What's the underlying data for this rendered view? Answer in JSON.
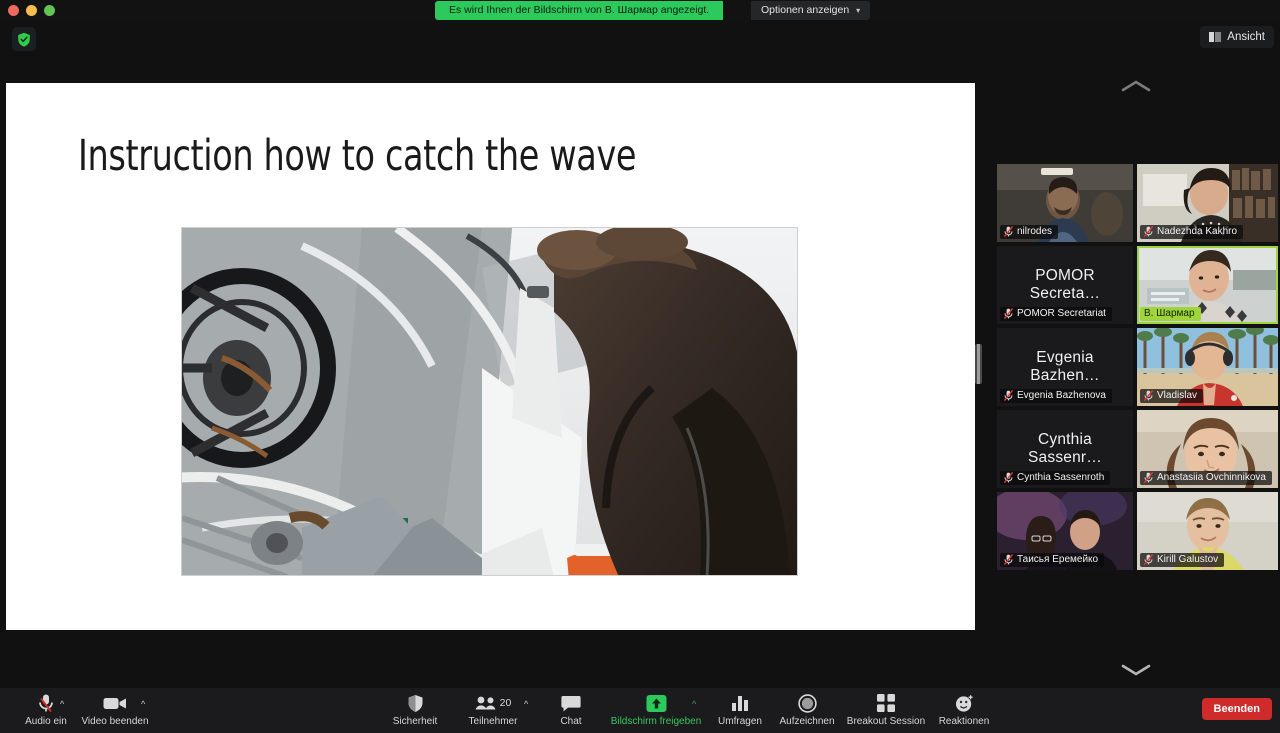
{
  "window": {
    "traffic_lights": [
      "close",
      "minimize",
      "zoom"
    ],
    "share_banner": "Es wird Ihnen der Bildschirm von B. Шармар angezeigt.",
    "share_options_label": "Optionen anzeigen",
    "view_button_label": "Ansicht",
    "security_badge": "shield-check-icon"
  },
  "shared_screen": {
    "slide_title": "Instruction how to catch the wave",
    "photo_alt": "Person in fur-hooded jacket climbing ship deck structure"
  },
  "participants_panel": {
    "scroll_up": "chevron-up-icon",
    "scroll_down": "chevron-down-icon",
    "tiles": [
      [
        {
          "name": "nilrodes",
          "initials": "",
          "muted": true,
          "video": true,
          "active": false,
          "vclass": "v-nilrodes"
        },
        {
          "name": "Nadezhda Kakhro",
          "initials": "",
          "muted": true,
          "video": true,
          "active": false,
          "vclass": "v-nadezhda"
        }
      ],
      [
        {
          "name": "POMOR Secretariat",
          "initials": "POMOR Secreta…",
          "muted": true,
          "video": false,
          "active": false,
          "vclass": ""
        },
        {
          "name": "В. Шармар",
          "initials": "",
          "muted": false,
          "video": true,
          "active": true,
          "vclass": "v-sharmap"
        }
      ],
      [
        {
          "name": "Evgenia Bazhenova",
          "initials": "Evgenia Bazhen…",
          "muted": true,
          "video": false,
          "active": false,
          "vclass": ""
        },
        {
          "name": "Vladislav",
          "initials": "",
          "muted": true,
          "video": true,
          "active": false,
          "vclass": "v-vladislav"
        }
      ],
      [
        {
          "name": "Cynthia Sassenroth",
          "initials": "Cynthia Sassenr…",
          "muted": true,
          "video": false,
          "active": false,
          "vclass": ""
        },
        {
          "name": "Anastasiia Ovchinnikova",
          "initials": "",
          "muted": true,
          "video": true,
          "active": false,
          "vclass": "v-anastasiia"
        }
      ],
      [
        {
          "name": "Таисья Еремейко",
          "initials": "",
          "muted": true,
          "video": true,
          "active": false,
          "vclass": "v-taisya"
        },
        {
          "name": "Kirill Galustov",
          "initials": "",
          "muted": true,
          "video": true,
          "active": false,
          "vclass": "v-kirill"
        }
      ]
    ]
  },
  "toolbar": {
    "audio": {
      "label": "Audio ein",
      "icon": "microphone-muted-icon",
      "has_caret": true
    },
    "video": {
      "label": "Video beenden",
      "icon": "camera-icon",
      "has_caret": true
    },
    "security": {
      "label": "Sicherheit",
      "icon": "shield-icon",
      "has_caret": false
    },
    "participants": {
      "label": "Teilnehmer",
      "icon": "participants-icon",
      "count": "20",
      "has_caret": true
    },
    "chat": {
      "label": "Chat",
      "icon": "chat-bubble-icon",
      "has_caret": false
    },
    "share": {
      "label": "Bildschirm freigeben",
      "icon": "share-screen-up-arrow-icon",
      "has_caret": true
    },
    "polls": {
      "label": "Umfragen",
      "icon": "bar-chart-icon",
      "has_caret": false
    },
    "record": {
      "label": "Aufzeichnen",
      "icon": "record-circle-icon",
      "has_caret": false
    },
    "breakout": {
      "label": "Breakout Session",
      "icon": "grid-squares-icon",
      "has_caret": false
    },
    "reactions": {
      "label": "Reaktionen",
      "icon": "smiley-plus-icon",
      "has_caret": false
    },
    "end": {
      "label": "Beenden"
    }
  },
  "colors": {
    "share_green": "#2cc95c",
    "accent_green": "#36c85f",
    "active_speaker": "#9fd43a",
    "end_red": "#cf2b2b",
    "mute_red": "#e03b3b"
  }
}
